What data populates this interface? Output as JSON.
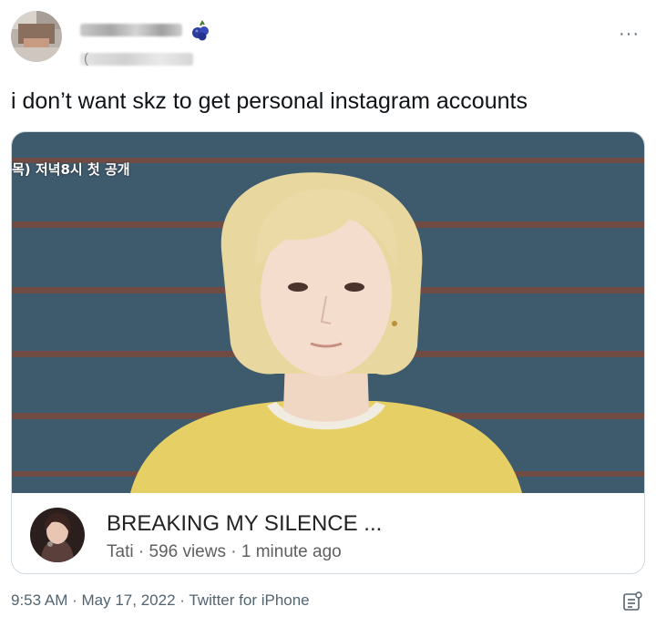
{
  "tweet": {
    "text": "i don’t want skz to get personal instagram accounts",
    "more_label": "···",
    "handle_paren": "(",
    "timestamp": {
      "time": "9:53 AM",
      "date": "May 17, 2022",
      "source": "Twitter for iPhone",
      "separator": "·"
    }
  },
  "card": {
    "overlay_text": "목) 저녁8시 첫 공개",
    "video_title": "BREAKING MY SILENCE ...",
    "channel": "Tati",
    "views": "596 views",
    "age": "1 minute ago",
    "separator": "·"
  },
  "colors": {
    "text": "#0f1419",
    "secondary": "#536471",
    "border": "#cfd9de",
    "video_bg": "#3e5a6d",
    "sweater": "#e6cf64",
    "hair": "#e9d7a0"
  },
  "icons": {
    "more": "more-icon",
    "emoji": "blueberry-icon",
    "analytics": "analytics-icon"
  }
}
